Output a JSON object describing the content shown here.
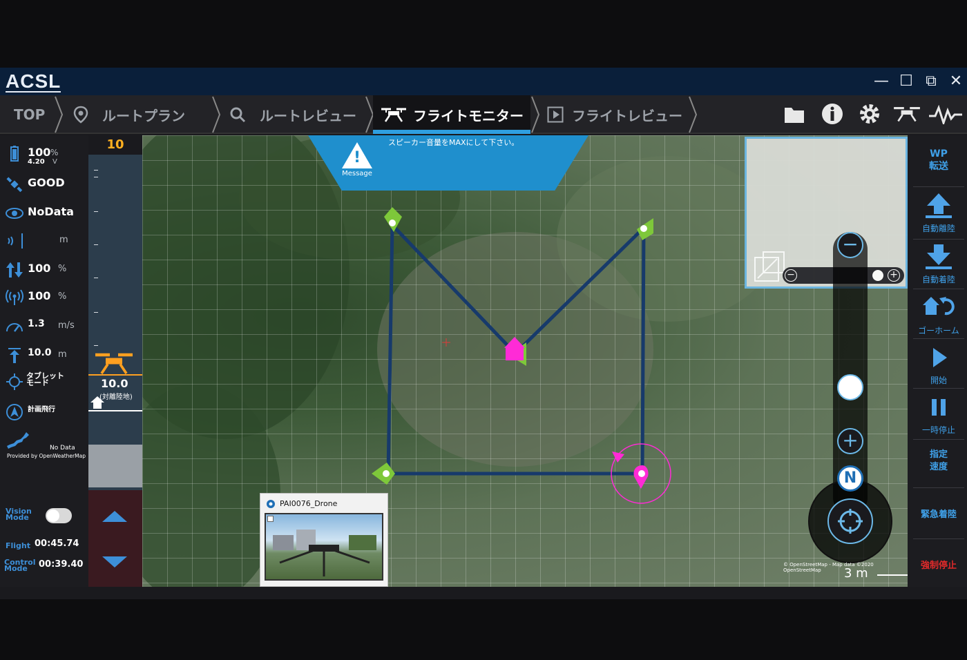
{
  "app": {
    "logo": "ACSL",
    "window_controls": {
      "minimize": "—",
      "maximize": "☐",
      "restore": "⧉",
      "close": "✕"
    }
  },
  "tabs": [
    {
      "label": "TOP",
      "icon": ""
    },
    {
      "label": "ルートプラン",
      "icon": "map-pin-icon"
    },
    {
      "label": "ルートレビュー",
      "icon": "search-icon"
    },
    {
      "label": "フライトモニター",
      "icon": "drone-icon",
      "active": true
    },
    {
      "label": "フライトレビュー",
      "icon": "play-icon"
    }
  ],
  "toolbar_icons": [
    "folder-icon",
    "info-icon",
    "gear-icon",
    "drone-icon",
    "waveform-icon"
  ],
  "left_panel": {
    "battery": {
      "percent": "100",
      "percent_unit": "%",
      "voltage": "4.20",
      "voltage_unit": "V"
    },
    "gps": "GOOD",
    "vision": "NoData",
    "distance_unit": "m",
    "throttle": {
      "value": "100",
      "unit": "%"
    },
    "signal": {
      "value": "100",
      "unit": "%"
    },
    "speed": {
      "value": "1.3",
      "unit": "m/s"
    },
    "altitude": {
      "value": "10.0",
      "unit": "m"
    },
    "tablet_mode": "タブレット\nモード",
    "plan_flight": "計画飛行",
    "weather": {
      "status": "No Data",
      "provider": "Provided by OpenWeatherMap"
    },
    "vision_mode_label": "Vision\nMode",
    "flight_label": "Flight",
    "flight_time": "00:45.74",
    "control_label": "Control\nMode",
    "control_time": "00:39.40"
  },
  "gauge": {
    "top_value": "10",
    "current": "10.0",
    "current_sub": "(対離陸地)"
  },
  "map": {
    "message": "スピーカー音量をMAXにして下さい。",
    "message_label": "Message",
    "attribution": "© OpenStreetMap - Map data ©2020 OpenStreetMap",
    "scale": "3 m",
    "north": "N",
    "camera": {
      "title": "PAI0076_Drone"
    }
  },
  "right_panel": [
    {
      "label": "WP\n転送",
      "icon": "",
      "style": "bold"
    },
    {
      "label": "自動離陸",
      "icon": "arrow-up-icon"
    },
    {
      "label": "自動着陸",
      "icon": "arrow-down-icon"
    },
    {
      "label": "ゴーホーム",
      "icon": "home-return-icon"
    },
    {
      "label": "開始",
      "icon": "play-icon"
    },
    {
      "label": "一時停止",
      "icon": "pause-icon"
    },
    {
      "label": "指定\n速度",
      "icon": "",
      "style": "bold"
    },
    {
      "label": "緊急着陸",
      "icon": "",
      "style": "bold"
    },
    {
      "label": "強制停止",
      "icon": "",
      "style": "stop"
    }
  ],
  "colors": {
    "accent": "#2f9fe0",
    "route": "#173a6b",
    "drone": "#ff2bd6",
    "waypoint": "#7ec83a",
    "stop": "#e02a2a"
  }
}
